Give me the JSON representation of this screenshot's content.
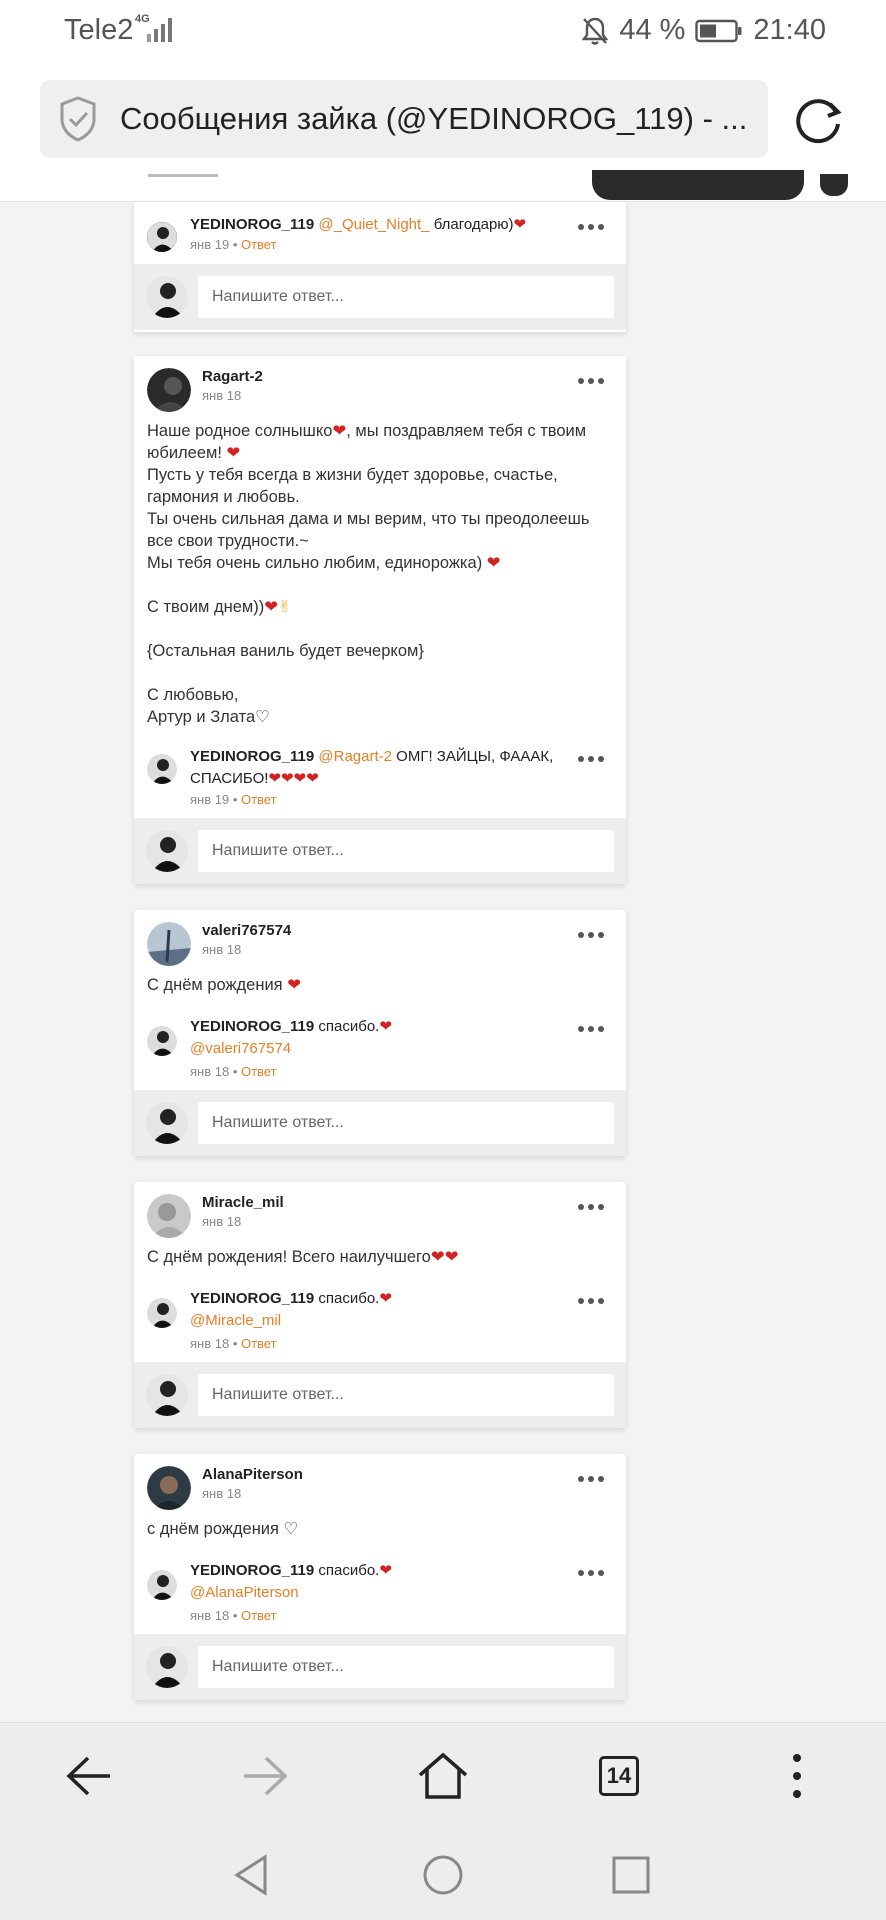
{
  "status_bar": {
    "carrier": "Tele2",
    "network": "4G",
    "battery": "44 %",
    "time": "21:40"
  },
  "browser": {
    "tab_title": "Сообщения зайка (@YEDINOROG_119) - ...",
    "tab_count": "14"
  },
  "reply_placeholder": "Напишите ответ...",
  "answer_label": "Ответ",
  "cards": [
    {
      "reply": {
        "author": "YEDINOROG_119",
        "mention": "@_Quiet_Night_",
        "text": "благодарю)",
        "date": "янв 19"
      }
    },
    {
      "author": "Ragart-2",
      "date": "янв 18",
      "lines": [
        "Наше родное солнышко",
        ", мы поздравляем тебя с твоим",
        "юбилеем! ",
        "Пусть у тебя всегда в жизни будет здоровье, счастье,",
        "гармония и любовь.",
        "Ты очень сильная дама и мы верим, что ты преодолеешь",
        "все свои трудности.~",
        "Мы тебя очень сильно любим, единорожка) ",
        "С твоим днем))",
        "{Остальная ваниль будет вечерком}",
        "С любовью,",
        "Артур и Злата♡"
      ],
      "reply": {
        "author": "YEDINOROG_119",
        "mention": "@Ragart-2",
        "text": "ОМГ! ЗАЙЦЫ, ФАААК,",
        "text2": "СПАСИБО!",
        "date": "янв 19"
      }
    },
    {
      "author": "valeri767574",
      "date": "янв 18",
      "text": "С днём рождения ",
      "reply": {
        "author": "YEDINOROG_119",
        "text": "спасибо.",
        "mention": "@valeri767574",
        "date": "янв 18"
      }
    },
    {
      "author": "Miracle_mil",
      "date": "янв 18",
      "text": "С днём рождения! Всего наилучшего",
      "reply": {
        "author": "YEDINOROG_119",
        "text": "спасибо.",
        "mention": "@Miracle_mil",
        "date": "янв 18"
      }
    },
    {
      "author": "AlanaPiterson",
      "date": "янв 18",
      "text": "с днём рождения ♡",
      "reply": {
        "author": "YEDINOROG_119",
        "text": "спасибо.",
        "mention": "@AlanaPiterson",
        "date": "янв 18"
      }
    }
  ],
  "colors": {
    "accent": "#e67e22",
    "heart": "#d32222"
  }
}
